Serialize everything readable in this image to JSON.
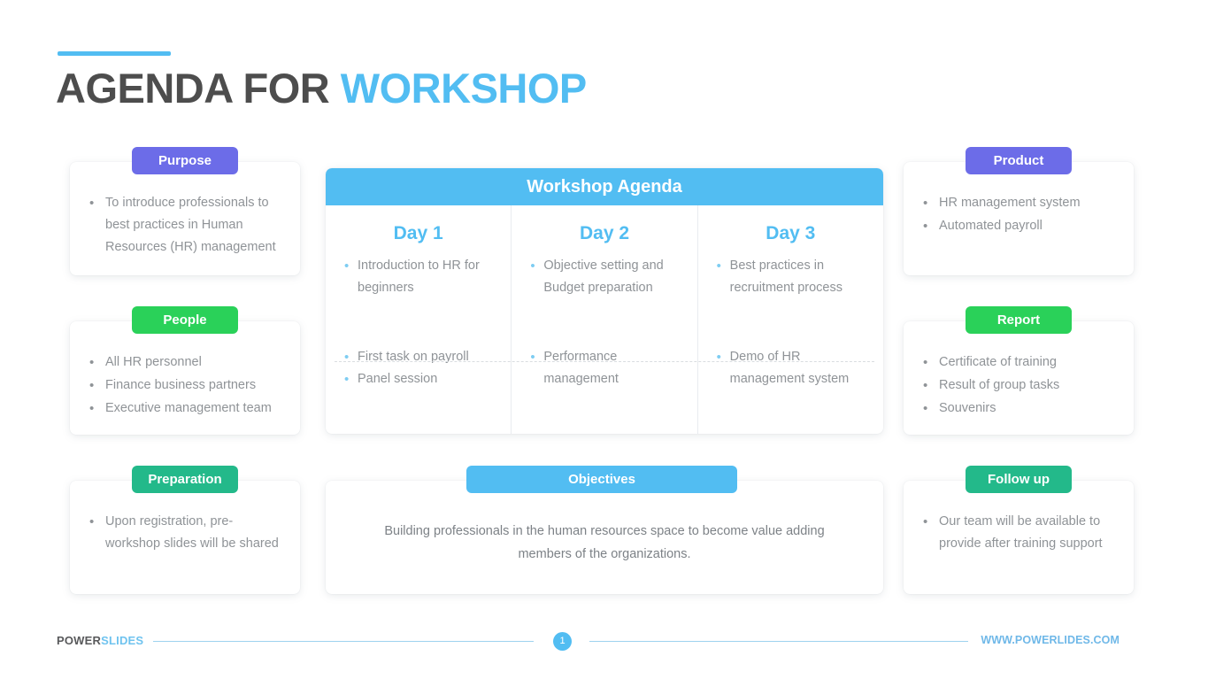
{
  "slide": {
    "title_main": "AGENDA FOR",
    "title_accent": "WORKSHOP"
  },
  "colors": {
    "blue": "#52bdf2",
    "purple": "#6c6ce8",
    "green": "#2ad159",
    "teal": "#23b98a",
    "title_gray": "#4d4d4d",
    "body_gray": "#8f9397"
  },
  "left_cards": [
    {
      "badge": "Purpose",
      "badge_color": "#6c6ce8",
      "bullets": [
        "To introduce professionals to best practices in Human Resources (HR) management"
      ]
    },
    {
      "badge": "People",
      "badge_color": "#2ad159",
      "bullets": [
        "All HR personnel",
        "Finance business partners",
        "Executive management team"
      ]
    },
    {
      "badge": "Preparation",
      "badge_color": "#23b98a",
      "bullets": [
        "Upon registration, pre-workshop slides will be shared"
      ]
    }
  ],
  "right_cards": [
    {
      "badge": "Product",
      "badge_color": "#6c6ce8",
      "bullets": [
        "HR management system",
        "Automated payroll"
      ]
    },
    {
      "badge": "Report",
      "badge_color": "#2ad159",
      "bullets": [
        "Certificate of training",
        "Result of group tasks",
        "Souvenirs"
      ]
    },
    {
      "badge": "Follow up",
      "badge_color": "#23b98a",
      "bullets": [
        "Our team will be available to provide after training support"
      ]
    }
  ],
  "agenda": {
    "header": "Workshop Agenda",
    "columns": [
      {
        "day": "Day 1",
        "row1": [
          "Introduction to HR for beginners"
        ],
        "row2": [
          "First task on payroll",
          "Panel session"
        ]
      },
      {
        "day": "Day 2",
        "row1": [
          "Objective setting and Budget preparation"
        ],
        "row2": [
          "Performance management"
        ]
      },
      {
        "day": "Day 3",
        "row1": [
          "Best practices in recruitment process"
        ],
        "row2": [
          "Demo of HR management system"
        ]
      }
    ]
  },
  "objectives": {
    "badge": "Objectives",
    "text": "Building professionals in the human resources space to become value adding members of the organizations."
  },
  "footer": {
    "logo_main": "POWER",
    "logo_accent": "SLIDES",
    "page_number": "1",
    "url": "WWW.POWERLIDES.COM"
  }
}
